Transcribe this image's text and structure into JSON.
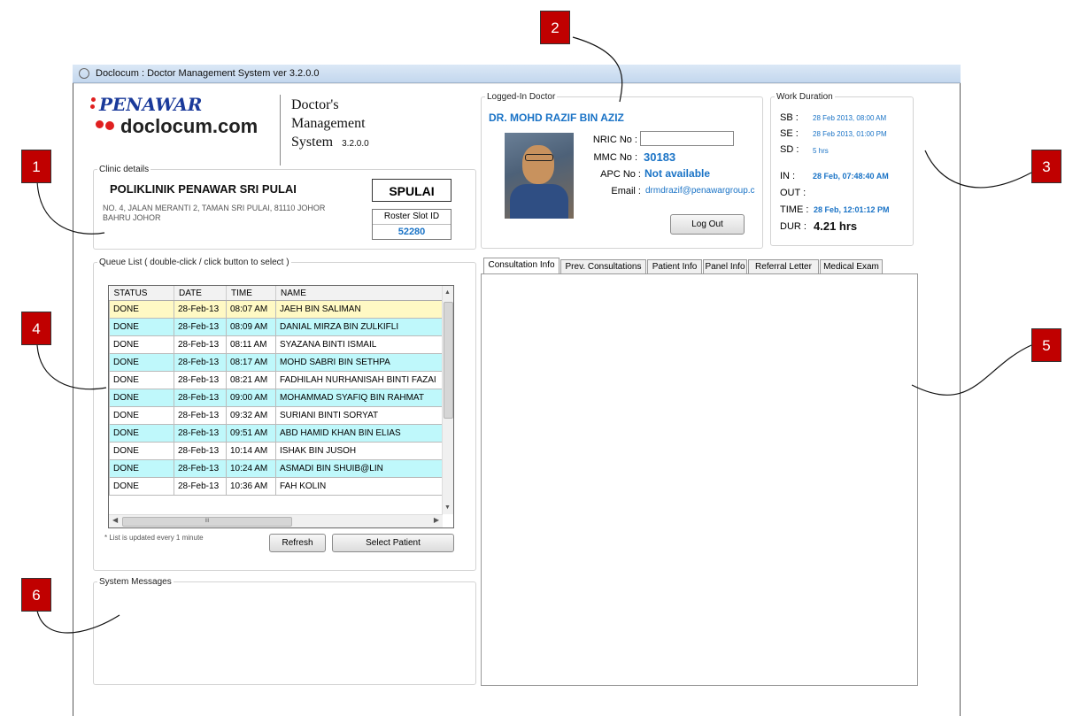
{
  "window": {
    "title": "Doclocum : Doctor Management System ver 3.2.0.0"
  },
  "brand": {
    "penawar": "PENAWAR",
    "doclocum": "doclocum.com",
    "line1": "Doctor's",
    "line2": "Management",
    "line3": "System",
    "version": "3.2.0.0"
  },
  "clinic": {
    "legend": "Clinic details",
    "name": "POLIKLINIK PENAWAR SRI PULAI",
    "address": "NO. 4, JALAN MERANTI 2, TAMAN SRI PULAI, 81110 JOHOR BAHRU JOHOR",
    "code": "SPULAI",
    "roster_label": "Roster Slot ID",
    "roster_value": "52280"
  },
  "doctor": {
    "legend": "Logged-In Doctor",
    "name": "DR. MOHD RAZIF BIN AZIZ",
    "nric_label": "NRIC No :",
    "nric_value": "",
    "mmc_label": "MMC No :",
    "mmc_value": "30183",
    "apc_label": "APC No :",
    "apc_value": "Not available",
    "email_label": "Email :",
    "email_value": "drmdrazif@penawargroup.c",
    "logout": "Log Out"
  },
  "work": {
    "legend": "Work Duration",
    "sb_label": "SB :",
    "sb_value": "28 Feb 2013, 08:00 AM",
    "se_label": "SE :",
    "se_value": "28 Feb 2013, 01:00 PM",
    "sd_label": "SD :",
    "sd_value": "5 hrs",
    "in_label": "IN :",
    "in_value": "28 Feb, 07:48:40 AM",
    "out_label": "OUT :",
    "out_value": "",
    "time_label": "TIME :",
    "time_value": "28 Feb, 12:01:12 PM",
    "dur_label": "DUR :",
    "dur_value": "4.21 hrs"
  },
  "queue": {
    "legend": "Queue List ( double-click / click button to select )",
    "columns": [
      "STATUS",
      "DATE",
      "TIME",
      "NAME"
    ],
    "rows": [
      {
        "status": "DONE",
        "date": "28-Feb-13",
        "time": "08:07 AM",
        "name": "JAEH BIN SALIMAN"
      },
      {
        "status": "DONE",
        "date": "28-Feb-13",
        "time": "08:09 AM",
        "name": "DANIAL MIRZA BIN ZULKIFLI"
      },
      {
        "status": "DONE",
        "date": "28-Feb-13",
        "time": "08:11 AM",
        "name": "SYAZANA BINTI ISMAIL"
      },
      {
        "status": "DONE",
        "date": "28-Feb-13",
        "time": "08:17 AM",
        "name": "MOHD SABRI BIN SETHPA"
      },
      {
        "status": "DONE",
        "date": "28-Feb-13",
        "time": "08:21 AM",
        "name": "FADHILAH NURHANISAH BINTI FAZAI"
      },
      {
        "status": "DONE",
        "date": "28-Feb-13",
        "time": "09:00 AM",
        "name": "MOHAMMAD SYAFIQ BIN RAHMAT"
      },
      {
        "status": "DONE",
        "date": "28-Feb-13",
        "time": "09:32 AM",
        "name": "SURIANI BINTI SORYAT"
      },
      {
        "status": "DONE",
        "date": "28-Feb-13",
        "time": "09:51 AM",
        "name": "ABD  HAMID KHAN BIN   ELIAS"
      },
      {
        "status": "DONE",
        "date": "28-Feb-13",
        "time": "10:14 AM",
        "name": "ISHAK BIN JUSOH"
      },
      {
        "status": "DONE",
        "date": "28-Feb-13",
        "time": "10:24 AM",
        "name": "ASMADI BIN SHUIB@LIN"
      },
      {
        "status": "DONE",
        "date": "28-Feb-13",
        "time": "10:36 AM",
        "name": "FAH KOLIN"
      }
    ],
    "scroll_mid": "III",
    "note": "* List is updated every 1 minute",
    "refresh": "Refresh",
    "select": "Select Patient"
  },
  "messages": {
    "legend": "System Messages"
  },
  "tabs": [
    "Consultation Info",
    "Prev. Consultations",
    "Patient Info",
    "Panel Info",
    "Referral Letter",
    "Medical Exam"
  ],
  "callouts": [
    "1",
    "2",
    "3",
    "4",
    "5",
    "6"
  ],
  "colors": {
    "selected_row": "#fff9c4",
    "alt_row": "#bff8fb",
    "link_blue": "#1a73c6",
    "callout_red": "#c00000"
  }
}
